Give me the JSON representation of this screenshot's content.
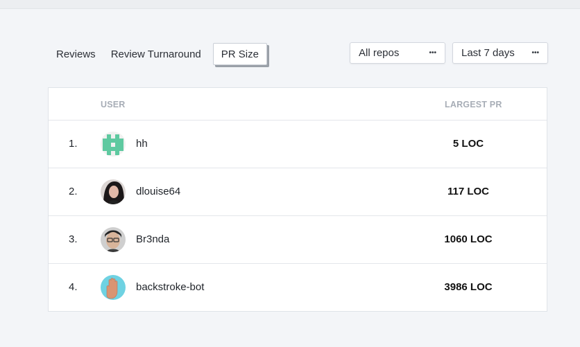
{
  "tabs": [
    {
      "label": "Reviews"
    },
    {
      "label": "Review Turnaround"
    },
    {
      "label": "PR Size"
    }
  ],
  "filters": {
    "repo": {
      "value": "All repos",
      "icon": "more-dots-icon"
    },
    "range": {
      "value": "Last 7 days",
      "icon": "more-dots-icon"
    }
  },
  "table": {
    "headers": {
      "user": "USER",
      "largest_pr": "LARGEST PR"
    },
    "rows": [
      {
        "rank": "1.",
        "user": "hh",
        "largest_pr": "5 LOC",
        "avatar": "identicon-avatar"
      },
      {
        "rank": "2.",
        "user": "dlouise64",
        "largest_pr": "117 LOC",
        "avatar": "photo-avatar"
      },
      {
        "rank": "3.",
        "user": "Br3nda",
        "largest_pr": "1060 LOC",
        "avatar": "photo-avatar"
      },
      {
        "rank": "4.",
        "user": "backstroke-bot",
        "largest_pr": "3986 LOC",
        "avatar": "hand-avatar"
      }
    ]
  },
  "colors": {
    "identicon": "#5ec9a0",
    "hand_bg": "#6fd2e2",
    "hand": "#d99472"
  }
}
